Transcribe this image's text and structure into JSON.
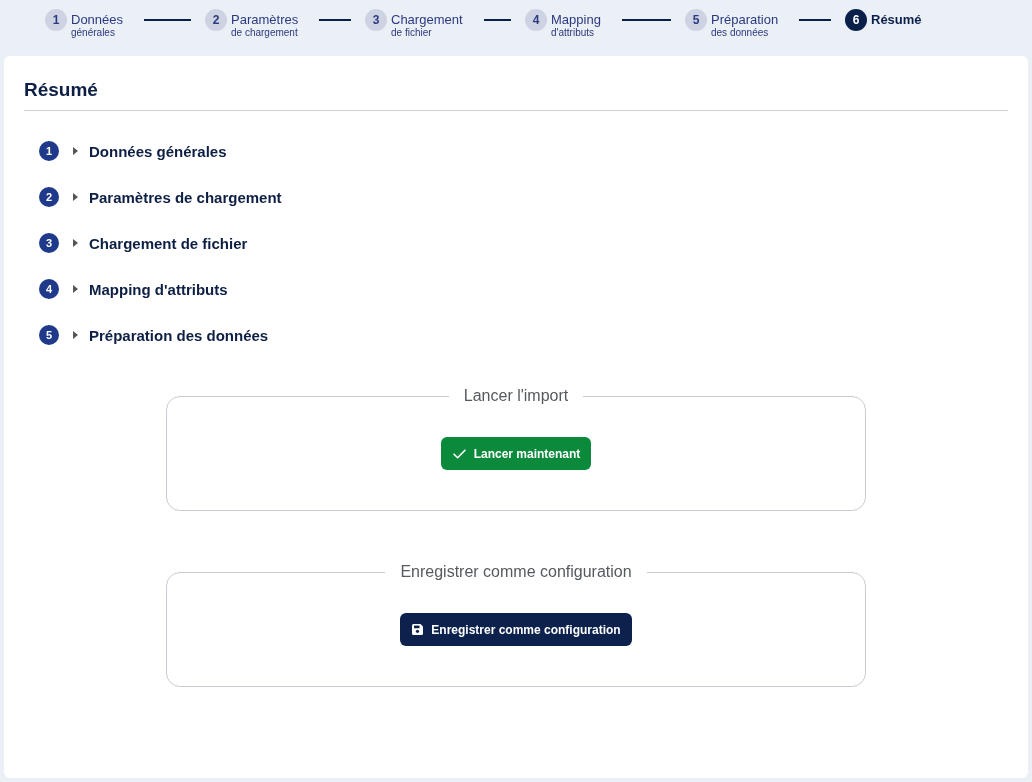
{
  "stepper": {
    "steps": [
      {
        "number": "1",
        "label": "Données",
        "sublabel": "générales",
        "selected": false
      },
      {
        "number": "2",
        "label": "Paramètres",
        "sublabel": "de chargement",
        "selected": false
      },
      {
        "number": "3",
        "label": "Chargement",
        "sublabel": "de fichier",
        "selected": false
      },
      {
        "number": "4",
        "label": "Mapping",
        "sublabel": "d'attributs",
        "selected": false
      },
      {
        "number": "5",
        "label": "Préparation",
        "sublabel": "des données",
        "selected": false
      },
      {
        "number": "6",
        "label": "Résumé",
        "selected": true
      }
    ]
  },
  "summary": {
    "title": "Résumé",
    "sections": [
      {
        "number": "1",
        "label": "Données générales",
        "expanded": false
      },
      {
        "number": "2",
        "label": "Paramètres de chargement",
        "expanded": false
      },
      {
        "number": "3",
        "label": "Chargement de fichier",
        "expanded": false
      },
      {
        "number": "4",
        "label": "Mapping d'attributs",
        "expanded": false
      },
      {
        "number": "5",
        "label": "Préparation des données",
        "expanded": false
      }
    ],
    "panels": [
      {
        "legend": "Lancer l'import",
        "button": {
          "kind": "launch",
          "label": "Lancer maintenant"
        }
      },
      {
        "legend": "Enregistrer comme configuration",
        "button": {
          "kind": "save",
          "label": "Enregistrer comme configuration"
        }
      }
    ]
  }
}
